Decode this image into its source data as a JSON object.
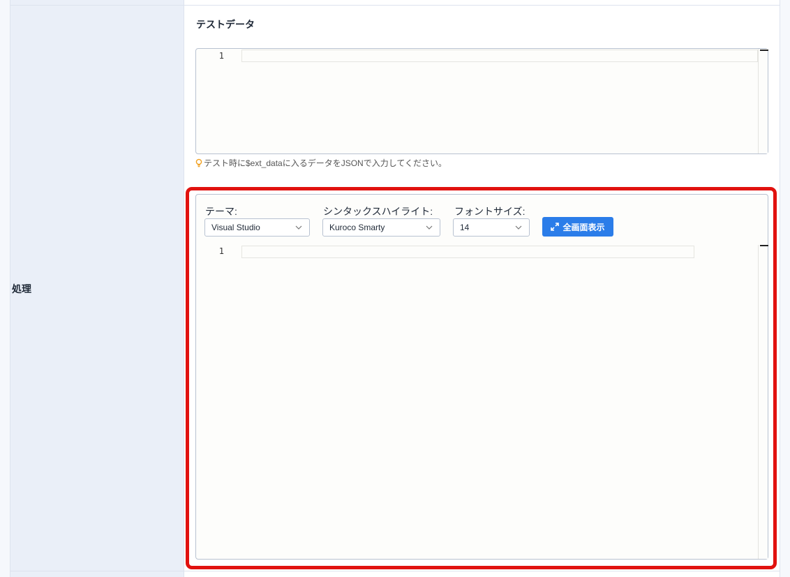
{
  "row": {
    "label": "処理"
  },
  "test_data": {
    "title": "テストデータ",
    "line_number": "1",
    "hint": "テスト時に$ext_dataに入るデータをJSONで入力してください。",
    "hint_icon": "lightbulb-icon"
  },
  "toolbar": {
    "theme_label": "テーマ:",
    "theme_value": "Visual Studio",
    "syntax_label": "シンタックスハイライト:",
    "syntax_value": "Kuroco Smarty",
    "fontsize_label": "フォントサイズ:",
    "fontsize_value": "14",
    "fullscreen_label": "全画面表示",
    "fullscreen_icon": "expand-arrows-icon"
  },
  "process_editor": {
    "line_number": "1"
  },
  "colors": {
    "highlight": "#e1120f",
    "button": "#2b7de9",
    "label_column": "#eaeff8",
    "hint_icon": "#f0a020"
  }
}
